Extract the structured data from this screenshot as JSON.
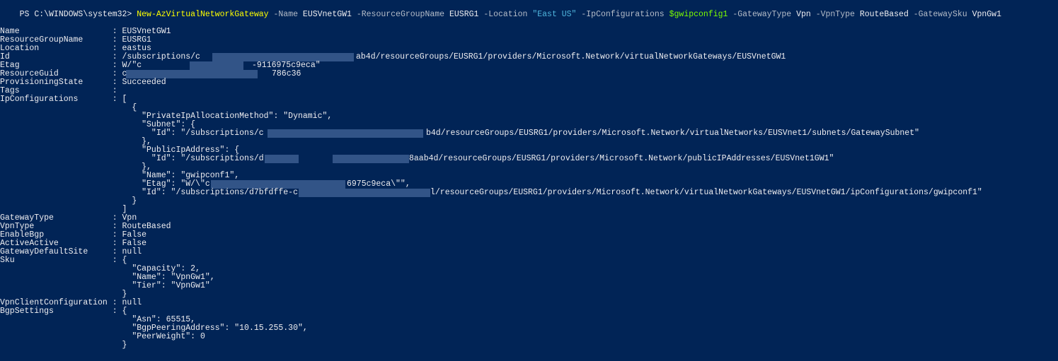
{
  "colors": {
    "background": "#012456",
    "text": "#eeedf0",
    "cmdlet": "#ffff00",
    "parameter": "#b5bcc8",
    "string": "#4fb5dd",
    "variable": "#7cfc00",
    "redaction": "#5b7cb0"
  },
  "prompt": {
    "prefix": "PS C:\\WINDOWS\\system32>",
    "cmdlet": "New-AzVirtualNetworkGateway",
    "p_name": "-Name",
    "v_name": "EUSVnetGW1",
    "p_rg": "-ResourceGroupName",
    "v_rg": "EUSRG1",
    "p_loc": "-Location",
    "v_loc": "\"East US\"",
    "p_ipc": "-IpConfigurations",
    "v_ipc": "$gwipconfig1",
    "p_gt": "-GatewayType",
    "v_gt": "Vpn",
    "p_vt": "-VpnType",
    "v_vt": "RouteBased",
    "p_sku": "-GatewaySku",
    "v_sku": "VpnGw1"
  },
  "output": {
    "name": "Name                   : EUSVnetGW1",
    "rg": "ResourceGroupName      : EUSRG1",
    "location": "Location               : eastus",
    "id_start": "Id                     : /subscriptions/c",
    "id_end": "ab4d/resourceGroups/EUSRG1/providers/Microsoft.Network/virtualNetworkGateways/EUSVnetGW1",
    "etag_start": "Etag                   : W/\"c",
    "etag_end": "-9116975c9eca\"",
    "guid_start": "ResourceGuid           : c",
    "guid_end": "786c36",
    "provisioning": "ProvisioningState      : Succeeded",
    "tags": "Tags                   :",
    "ipconf": "IpConfigurations       : [",
    "ip_open": "                           {",
    "ip_alloc": "                             \"PrivateIpAllocationMethod\": \"Dynamic\",",
    "ip_subnet": "                             \"Subnet\": {",
    "ip_subnet_id_start": "                               \"Id\": \"/subscriptions/c",
    "ip_subnet_id_end": "b4d/resourceGroups/EUSRG1/providers/Microsoft.Network/virtualNetworks/EUSVnet1/subnets/GatewaySubnet\"",
    "ip_subnet_close": "                             },",
    "ip_pip": "                             \"PublicIpAddress\": {",
    "ip_pip_id_start": "                               \"Id\": \"/subscriptions/d",
    "ip_pip_id_end": "8aab4d/resourceGroups/EUSRG1/providers/Microsoft.Network/publicIPAddresses/EUSVnet1GW1\"",
    "ip_pip_close": "                             },",
    "ip_name": "                             \"Name\": \"gwipconf1\",",
    "ip_etag_start": "                             \"Etag\": \"W/\\\"c",
    "ip_etag_end": "6975c9eca\\\"\",",
    "ip_id_start": "                             \"Id\": \"/subscriptions/d7bfdffe-c",
    "ip_id_end": "l/resourceGroups/EUSRG1/providers/Microsoft.Network/virtualNetworkGateways/EUSVnetGW1/ipConfigurations/gwipconf1\"",
    "ip_close": "                           }",
    "ipconf_close": "                         ]",
    "gwtype": "GatewayType            : Vpn",
    "vpntype": "VpnType                : RouteBased",
    "bgp": "EnableBgp              : False",
    "aa": "ActiveActive           : False",
    "defsite": "GatewayDefaultSite     : null",
    "sku": "Sku                    : {",
    "sku_cap": "                           \"Capacity\": 2,",
    "sku_name": "                           \"Name\": \"VpnGw1\",",
    "sku_tier": "                           \"Tier\": \"VpnGw1\"",
    "sku_close": "                         }",
    "vpnclient": "VpnClientConfiguration : null",
    "bgpsettings": "BgpSettings            : {",
    "bgp_asn": "                           \"Asn\": 65515,",
    "bgp_peer": "                           \"BgpPeeringAddress\": \"10.15.255.30\",",
    "bgp_weight": "                           \"PeerWeight\": 0",
    "bgp_close": "                         }"
  }
}
